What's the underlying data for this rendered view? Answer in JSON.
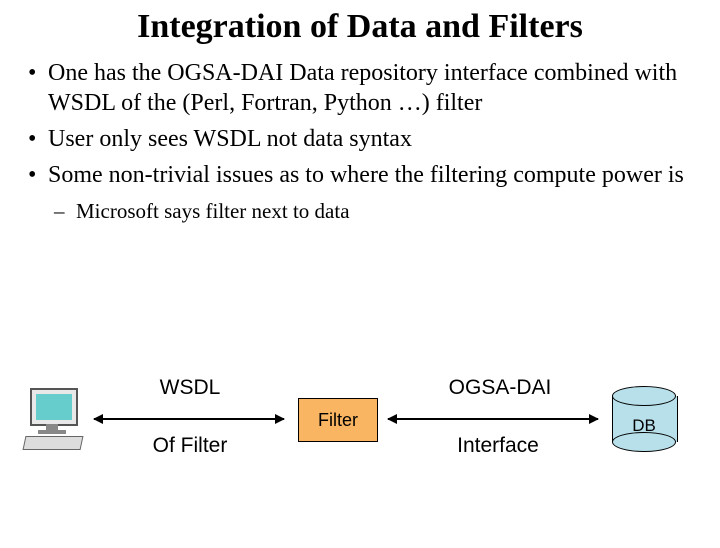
{
  "title": "Integration of Data and Filters",
  "bullets": {
    "b1": "One has the OGSA-DAI Data repository interface combined with WSDL of the (Perl, Fortran, Python …) filter",
    "b2": "User only sees WSDL not data syntax",
    "b3": "Some non-trivial issues as to where the filtering compute power is",
    "sub1": "Microsoft says filter next to data"
  },
  "diagram": {
    "wsdl_top": "WSDL",
    "wsdl_bottom": "Of Filter",
    "filter": "Filter",
    "ogsa_top": "OGSA-DAI",
    "ogsa_bottom": "Interface",
    "db": "DB"
  }
}
